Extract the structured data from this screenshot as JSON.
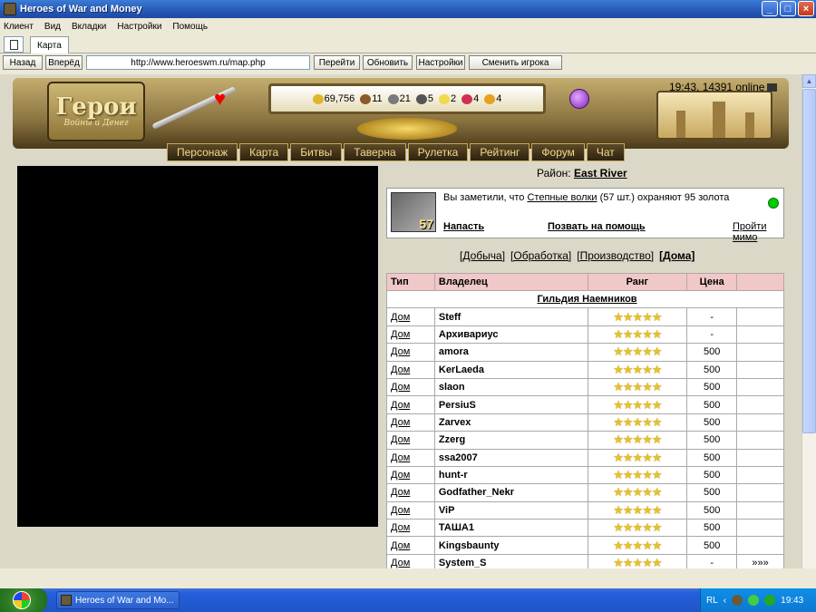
{
  "window": {
    "title": "Heroes of War and Money"
  },
  "menu": [
    "Клиент",
    "Вид",
    "Вкладки",
    "Настройки",
    "Помощь"
  ],
  "tabs": {
    "active": "Карта"
  },
  "nav": {
    "back": "Назад",
    "forward": "Вперёд",
    "url": "http://www.heroeswm.ru/map.php",
    "go": "Перейти",
    "refresh": "Обновить",
    "settings": "Настройки",
    "change_player": "Сменить игрока"
  },
  "game": {
    "logo_main": "Герои",
    "logo_sub": "Войны и Денег",
    "status": "19:43, 14391 online",
    "resources": [
      {
        "icon": "gold-icon",
        "value": "69,756"
      },
      {
        "icon": "wood-icon",
        "value": "11"
      },
      {
        "icon": "ore-icon",
        "value": "21"
      },
      {
        "icon": "mercury-icon",
        "value": "5"
      },
      {
        "icon": "sulfur-icon",
        "value": "2"
      },
      {
        "icon": "crystal-icon",
        "value": "4"
      },
      {
        "icon": "gem-icon",
        "value": "4"
      }
    ],
    "menu": [
      "Персонаж",
      "Карта",
      "Битвы",
      "Таверна",
      "Рулетка",
      "Рейтинг",
      "Форум",
      "Чат"
    ]
  },
  "district": {
    "label": "Район:",
    "value": "East River"
  },
  "event": {
    "count": "57",
    "text_before": "Вы заметили, что",
    "creature": "Степные волки",
    "text_after": "(57 шт.) охраняют 95 золота",
    "attack": "Напасть",
    "call_help": "Позвать на помощь",
    "pass_by": "Пройти мимо"
  },
  "filters": [
    "[Добыча]",
    "[Обработка]",
    "[Производство]",
    "[Дома]"
  ],
  "table": {
    "headers": [
      "Тип",
      "Владелец",
      "Ранг",
      "Цена",
      ""
    ],
    "guild": "Гильдия Наемников",
    "rows": [
      {
        "type": "Дом",
        "owner": "Steff",
        "rank": "★★★★★",
        "price": "-",
        "extra": ""
      },
      {
        "type": "Дом",
        "owner": "Архивариус",
        "rank": "★★★★★",
        "price": "-",
        "extra": ""
      },
      {
        "type": "Дом",
        "owner": "amora",
        "rank": "★★★★★",
        "price": "500",
        "extra": ""
      },
      {
        "type": "Дом",
        "owner": "KerLaeda",
        "rank": "★★★★★",
        "price": "500",
        "extra": ""
      },
      {
        "type": "Дом",
        "owner": "slaon",
        "rank": "★★★★★",
        "price": "500",
        "extra": ""
      },
      {
        "type": "Дом",
        "owner": "PersiuS",
        "rank": "★★★★★",
        "price": "500",
        "extra": ""
      },
      {
        "type": "Дом",
        "owner": "Zarvex",
        "rank": "★★★★★",
        "price": "500",
        "extra": ""
      },
      {
        "type": "Дом",
        "owner": "Zzerg",
        "rank": "★★★★★",
        "price": "500",
        "extra": ""
      },
      {
        "type": "Дом",
        "owner": "ssa2007",
        "rank": "★★★★★",
        "price": "500",
        "extra": ""
      },
      {
        "type": "Дом",
        "owner": "hunt-r",
        "rank": "★★★★★",
        "price": "500",
        "extra": ""
      },
      {
        "type": "Дом",
        "owner": "Godfather_Nekr",
        "rank": "★★★★★",
        "price": "500",
        "extra": ""
      },
      {
        "type": "Дом",
        "owner": "ViP",
        "rank": "★★★★★",
        "price": "500",
        "extra": ""
      },
      {
        "type": "Дом",
        "owner": "ТАША1",
        "rank": "★★★★★",
        "price": "500",
        "extra": ""
      },
      {
        "type": "Дом",
        "owner": "Kingsbaunty",
        "rank": "★★★★★",
        "price": "500",
        "extra": ""
      },
      {
        "type": "Дом",
        "owner": "System_S",
        "rank": "★★★★★",
        "price": "-",
        "extra": "»»»"
      }
    ]
  },
  "taskbar": {
    "item": "Heroes of War and Mo...",
    "lang": "RL",
    "time": "19:43"
  }
}
